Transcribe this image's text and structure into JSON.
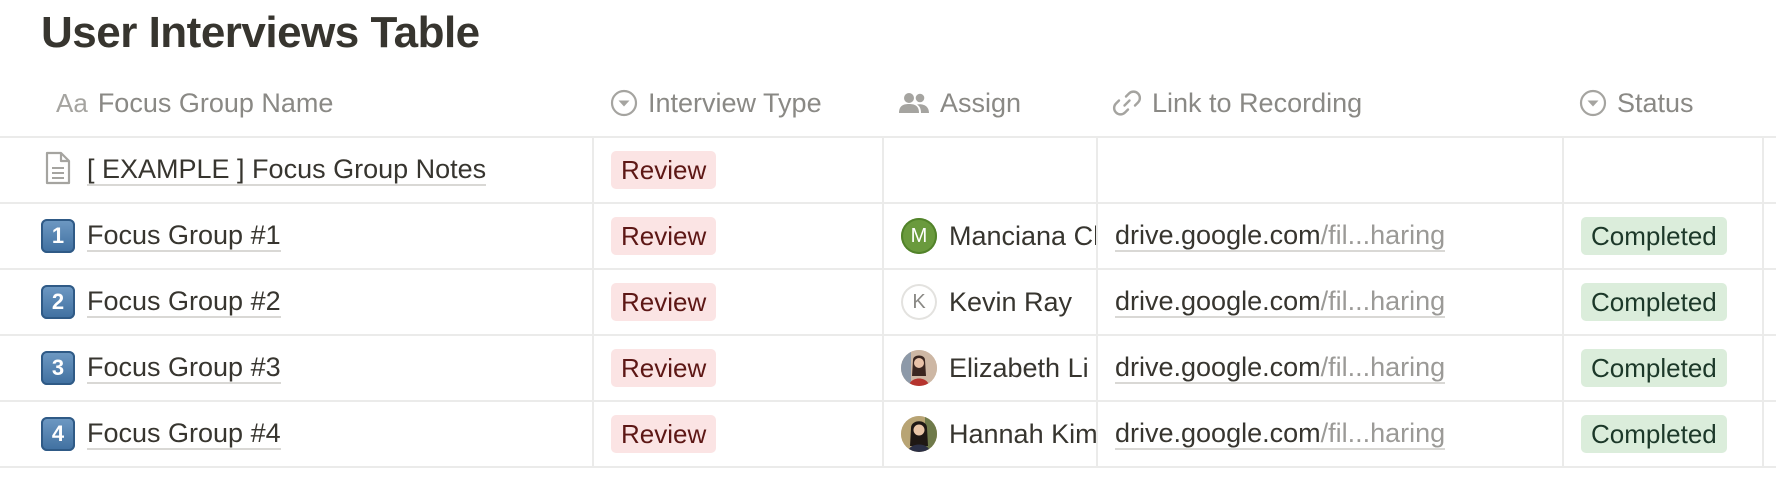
{
  "page": {
    "title": "User Interviews Table"
  },
  "columns": [
    {
      "label": "Focus Group Name",
      "icon": "text-icon",
      "icon_text": "Aa"
    },
    {
      "label": "Interview Type",
      "icon": "select-icon"
    },
    {
      "label": "Assign",
      "icon": "people-icon"
    },
    {
      "label": "Link to Recording",
      "icon": "link-icon"
    },
    {
      "label": "Status",
      "icon": "select-icon"
    }
  ],
  "rows": [
    {
      "icon": "document-icon",
      "name": "[ EXAMPLE ] Focus Group Notes",
      "type": "Review",
      "assign": null,
      "link": null,
      "status": null
    },
    {
      "icon": "keycap-1-icon",
      "icon_text": "1",
      "name": "Focus Group #1",
      "type": "Review",
      "assign": {
        "name": "Manciana Chen",
        "initial": "M",
        "avatar": "initial-green"
      },
      "link": {
        "domain": "drive.google.com",
        "path": "/fil...haring"
      },
      "status": "Completed"
    },
    {
      "icon": "keycap-2-icon",
      "icon_text": "2",
      "name": "Focus Group #2",
      "type": "Review",
      "assign": {
        "name": "Kevin Ray",
        "initial": "K",
        "avatar": "initial-outline"
      },
      "link": {
        "domain": "drive.google.com",
        "path": "/fil...haring"
      },
      "status": "Completed"
    },
    {
      "icon": "keycap-3-icon",
      "icon_text": "3",
      "name": "Focus Group #3",
      "type": "Review",
      "assign": {
        "name": "Elizabeth Li",
        "initial": "",
        "avatar": "photo"
      },
      "link": {
        "domain": "drive.google.com",
        "path": "/fil...haring"
      },
      "status": "Completed"
    },
    {
      "icon": "keycap-4-icon",
      "icon_text": "4",
      "name": "Focus Group #4",
      "type": "Review",
      "assign": {
        "name": "Hannah Kim",
        "initial": "",
        "avatar": "photo"
      },
      "link": {
        "domain": "drive.google.com",
        "path": "/fil...haring"
      },
      "status": "Completed"
    }
  ],
  "colors": {
    "review_bg": "#fbe4e4",
    "review_text": "#5d1715",
    "completed_bg": "#dbeddb",
    "completed_text": "#1c3829",
    "grid_line": "#ebebea"
  }
}
